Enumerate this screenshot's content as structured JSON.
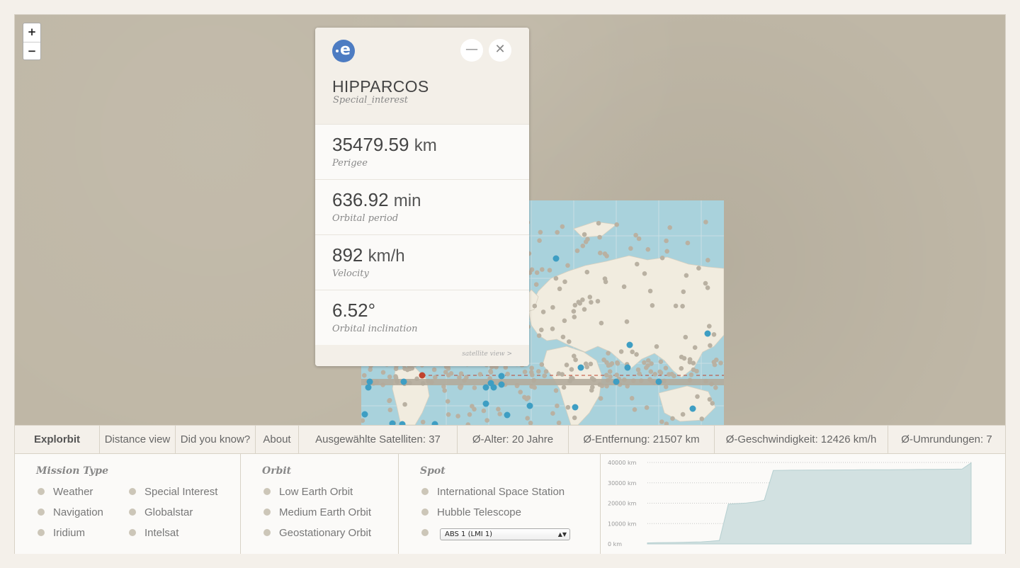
{
  "map": {
    "zoom_in": "+",
    "zoom_out": "−",
    "satellite_dot_color_blue": "#3e9ec3",
    "satellite_dot_color_grey": "#b9b1a2",
    "selected_marker_color": "#c0432e"
  },
  "card": {
    "logo_letter": "e",
    "minimize_label": "—",
    "close_label": "✕",
    "title": "HIPPARCOS",
    "subtitle": "Special_interest",
    "stats": [
      {
        "value": "35479.59",
        "unit": "km",
        "label": "Perigee"
      },
      {
        "value": "636.92",
        "unit": "min",
        "label": "Orbital period"
      },
      {
        "value": "892",
        "unit": "km/h",
        "label": "Velocity"
      },
      {
        "value": "6.52°",
        "unit": "",
        "label": "Orbital inclination"
      }
    ],
    "footer_link": "satellite view >"
  },
  "nav": {
    "brand": "Explorbit",
    "distance": "Distance view",
    "didyouknow": "Did you know?",
    "about": "About",
    "selected": "Ausgewählte Satelliten: 37",
    "age": "Ø-Alter: 20 Jahre",
    "distance_avg": "Ø-Entfernung: 21507 km",
    "speed": "Ø-Geschwindigkeit: 12426 km/h",
    "orbits": "Ø-Umrundungen: 7"
  },
  "filters": {
    "mission": {
      "heading": "Mission Type",
      "items": [
        "Weather",
        "Navigation",
        "Iridium",
        "Special Interest",
        "Globalstar",
        "Intelsat"
      ]
    },
    "orbit": {
      "heading": "Orbit",
      "items": [
        "Low Earth Orbit",
        "Medium Earth Orbit",
        "Geostationary Orbit"
      ]
    },
    "spot": {
      "heading": "Spot",
      "items": [
        "International Space Station",
        "Hubble Telescope"
      ],
      "select_value": "ABS 1 (LMI 1)"
    }
  },
  "chart_data": {
    "type": "area",
    "title": "",
    "xlabel": "",
    "ylabel": "",
    "yticks": [
      "40000 km",
      "30000 km",
      "20000 km",
      "10000 km",
      "0 km"
    ],
    "ylim": [
      0,
      40000
    ],
    "x": [
      0,
      1,
      2,
      3,
      4,
      5,
      6,
      7,
      8,
      9,
      10,
      11,
      12,
      13,
      14,
      15,
      16,
      17,
      18,
      19,
      20,
      21,
      22,
      23,
      24,
      25,
      26,
      27,
      28,
      29,
      30,
      31,
      32,
      33,
      34,
      35,
      36
    ],
    "values": [
      500,
      600,
      650,
      700,
      800,
      900,
      1000,
      1300,
      1700,
      19500,
      19800,
      20100,
      20600,
      21500,
      36100,
      36150,
      36200,
      36200,
      36250,
      36250,
      36300,
      36300,
      36350,
      36350,
      36400,
      36400,
      36450,
      36450,
      36500,
      36500,
      36550,
      36600,
      36600,
      36650,
      36700,
      36750,
      39800
    ],
    "fill": "#d2e1e1",
    "stroke": "#b5cfd0"
  }
}
